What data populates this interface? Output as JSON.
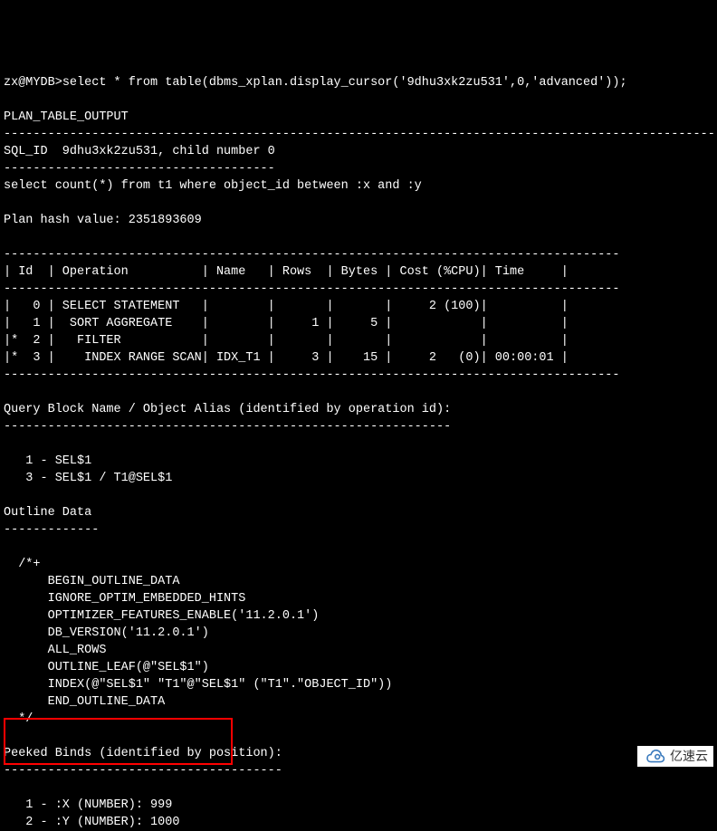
{
  "prompt": "zx@MYDB>",
  "command": "select * from table(dbms_xplan.display_cursor('9dhu3xk2zu531',0,'advanced'));",
  "header_line": "PLAN_TABLE_OUTPUT",
  "dash97": "-------------------------------------------------------------------------------------------------",
  "sql_id_line": "SQL_ID  9dhu3xk2zu531, child number 0",
  "dash37": "-------------------------------------",
  "query_text": "select count(*) from t1 where object_id between :x and :y",
  "plan_hash": "Plan hash value: 2351893609",
  "plan_border": "------------------------------------------------------------------------------------",
  "plan_header": "| Id  | Operation          | Name   | Rows  | Bytes | Cost (%CPU)| Time     |",
  "plan_rows": [
    "|   0 | SELECT STATEMENT   |        |       |       |     2 (100)|          |",
    "|   1 |  SORT AGGREGATE    |        |     1 |     5 |            |          |",
    "|*  2 |   FILTER           |        |       |       |            |          |",
    "|*  3 |    INDEX RANGE SCAN| IDX_T1 |     3 |    15 |     2   (0)| 00:00:01 |"
  ],
  "qb_header": "Query Block Name / Object Alias (identified by operation id):",
  "qb_dash": "-------------------------------------------------------------",
  "qb_lines": [
    "   1 - SEL$1",
    "   3 - SEL$1 / T1@SEL$1"
  ],
  "outline_header": "Outline Data",
  "outline_dash": "-------------",
  "outline_open": "  /*+",
  "outline_lines": [
    "      BEGIN_OUTLINE_DATA",
    "      IGNORE_OPTIM_EMBEDDED_HINTS",
    "      OPTIMIZER_FEATURES_ENABLE('11.2.0.1')",
    "      DB_VERSION('11.2.0.1')",
    "      ALL_ROWS",
    "      OUTLINE_LEAF(@\"SEL$1\")",
    "      INDEX(@\"SEL$1\" \"T1\"@\"SEL$1\" (\"T1\".\"OBJECT_ID\"))",
    "      END_OUTLINE_DATA"
  ],
  "outline_close": "  */",
  "binds_header": "Peeked Binds (identified by position):",
  "binds_dash": "--------------------------------------",
  "binds_lines": [
    "   1 - :X (NUMBER): 999",
    "   2 - :Y (NUMBER): 1000"
  ],
  "watermark_text": "亿速云",
  "chart_data": {
    "type": "table",
    "title": "Execution Plan",
    "sql_id": "9dhu3xk2zu531",
    "child_number": 0,
    "plan_hash_value": 2351893609,
    "columns": [
      "Id",
      "Operation",
      "Name",
      "Rows",
      "Bytes",
      "Cost (%CPU)",
      "Time"
    ],
    "rows": [
      {
        "id": 0,
        "filter": false,
        "operation": "SELECT STATEMENT",
        "name": "",
        "rows": null,
        "bytes": null,
        "cost": "2 (100)",
        "time": ""
      },
      {
        "id": 1,
        "filter": false,
        "operation": "SORT AGGREGATE",
        "name": "",
        "rows": 1,
        "bytes": 5,
        "cost": "",
        "time": ""
      },
      {
        "id": 2,
        "filter": true,
        "operation": "FILTER",
        "name": "",
        "rows": null,
        "bytes": null,
        "cost": "",
        "time": ""
      },
      {
        "id": 3,
        "filter": true,
        "operation": "INDEX RANGE SCAN",
        "name": "IDX_T1",
        "rows": 3,
        "bytes": 15,
        "cost": "2   (0)",
        "time": "00:00:01"
      }
    ],
    "peeked_binds": [
      {
        "pos": 1,
        "name": ":X",
        "type": "NUMBER",
        "value": 999
      },
      {
        "pos": 2,
        "name": ":Y",
        "type": "NUMBER",
        "value": 1000
      }
    ]
  }
}
